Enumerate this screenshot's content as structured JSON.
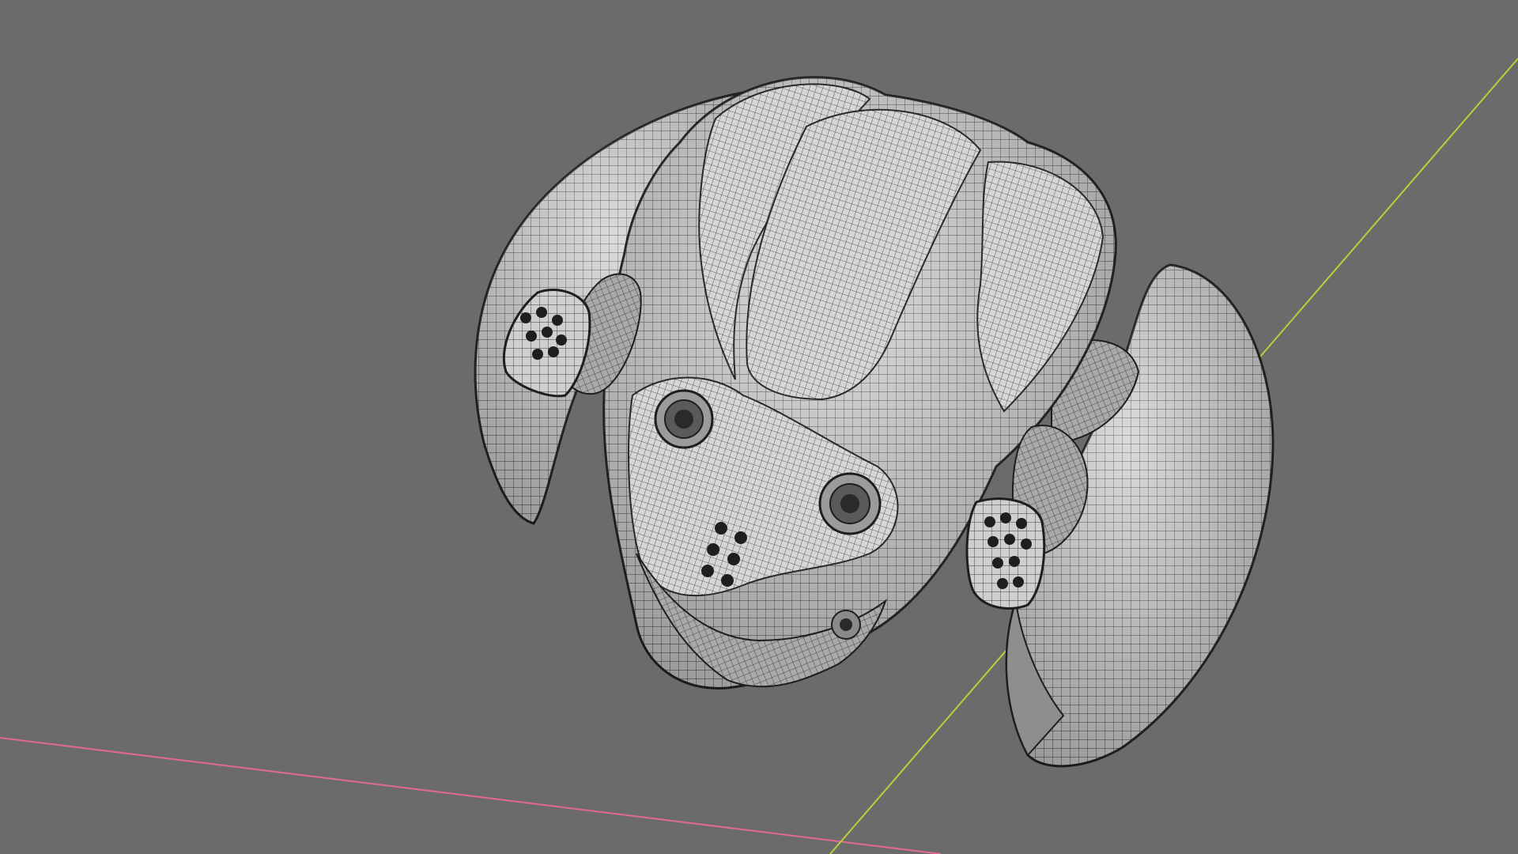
{
  "viewport": {
    "background_color": "#6b6b6b",
    "x_axis_color": "#e06b8a",
    "y_axis_color": "#b7d13a",
    "mesh_surface_color": "#c8c8c8",
    "mesh_wire_color": "#3a3a3a"
  },
  "model": {
    "display_mode": "wireframe-on-shaded",
    "parts": [
      "left-wing-shell",
      "right-wing-shell",
      "central-dome",
      "left-thruster",
      "right-thruster",
      "left-eye-sensor",
      "right-eye-sensor",
      "vent-cluster",
      "bottom-lens"
    ]
  }
}
